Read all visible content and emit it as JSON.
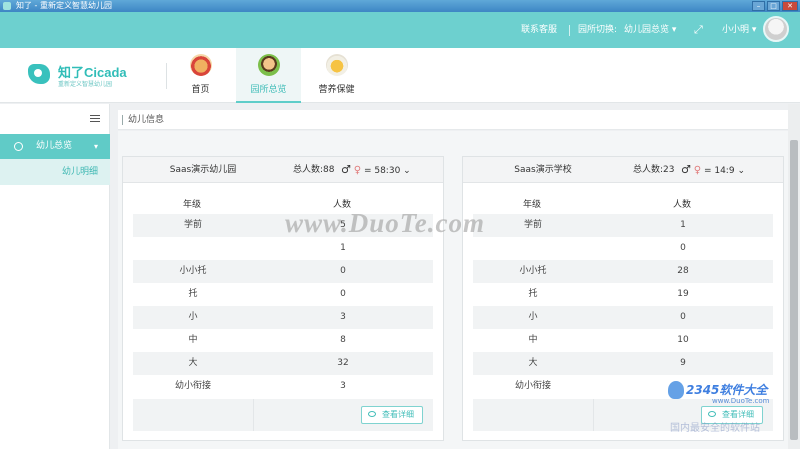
{
  "window": {
    "title": "知了 - 重新定义智慧幼儿园"
  },
  "topbar": {
    "service": "联系客服",
    "switch_label": "园所切换:",
    "switch_value": "幼儿园总览",
    "user": "小小明"
  },
  "logo": {
    "name": "知了Cicada",
    "slogan": "重新定义智慧幼儿园"
  },
  "nav": {
    "tabs": [
      {
        "label": "首页"
      },
      {
        "label": "园所总览"
      },
      {
        "label": "营养保健"
      }
    ]
  },
  "sidebar": {
    "group": "幼儿总览",
    "sub": "幼儿明细"
  },
  "breadcrumb": "幼儿信息",
  "cards": [
    {
      "name": "Saas演示幼儿园",
      "total": "总人数:88",
      "ratio": "= 58:30",
      "col_grade": "年级",
      "col_count": "人数",
      "rows": [
        {
          "grade": "学前",
          "count": "5"
        },
        {
          "grade": "",
          "count": "1"
        },
        {
          "grade": "小小托",
          "count": "0"
        },
        {
          "grade": "托",
          "count": "0"
        },
        {
          "grade": "小",
          "count": "3"
        },
        {
          "grade": "中",
          "count": "8"
        },
        {
          "grade": "大",
          "count": "32"
        },
        {
          "grade": "幼小衔接",
          "count": "3"
        }
      ],
      "detail": "查看详细"
    },
    {
      "name": "Saas演示学校",
      "total": "总人数:23",
      "ratio": "= 14:9",
      "col_grade": "年级",
      "col_count": "人数",
      "rows": [
        {
          "grade": "学前",
          "count": "1"
        },
        {
          "grade": "",
          "count": "0"
        },
        {
          "grade": "小小托",
          "count": "28"
        },
        {
          "grade": "托",
          "count": "19"
        },
        {
          "grade": "小",
          "count": "0"
        },
        {
          "grade": "中",
          "count": "10"
        },
        {
          "grade": "大",
          "count": "9"
        },
        {
          "grade": "幼小衔接",
          "count": ""
        }
      ],
      "detail": "查看详细"
    }
  ],
  "watermarks": {
    "duote": "www.DuoTe.com",
    "brand": "2345软件大全",
    "brand_url": "www.DuoTe.com",
    "brand_cn": "国内最安全的软件站"
  }
}
